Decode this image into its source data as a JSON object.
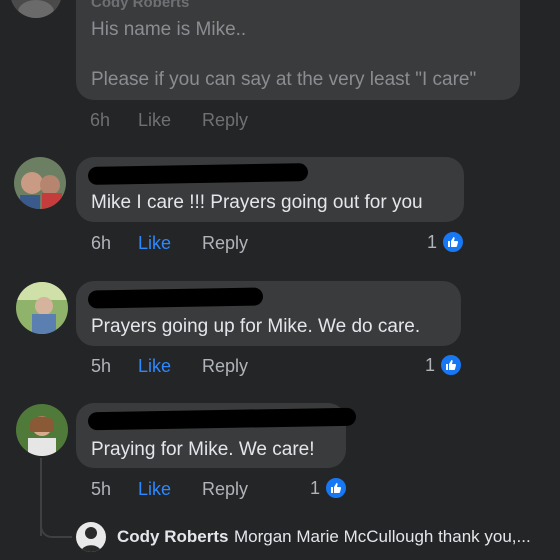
{
  "top_comment": {
    "author": "Cody Roberts",
    "line1": "His name is Mike..",
    "line2": "Please if you can say at the very least \"I care\"",
    "time": "6h",
    "like": "Like",
    "reply": "Reply"
  },
  "comments": [
    {
      "text": "Mike I care !!! Prayers going out for you",
      "time": "6h",
      "like": "Like",
      "reply": "Reply",
      "reactions": "1"
    },
    {
      "text": "Prayers going up for Mike. We do care.",
      "time": "5h",
      "like": "Like",
      "reply": "Reply",
      "reactions": "1"
    },
    {
      "text": "Praying for Mike. We care!",
      "time": "5h",
      "like": "Like",
      "reply": "Reply",
      "reactions": "1"
    }
  ],
  "reply_preview": {
    "author": "Cody Roberts",
    "text": "Morgan Marie McCullough thank you,..."
  },
  "colors": {
    "background": "#242526",
    "bubble": "#3a3b3c",
    "like_blue": "#2d88ff",
    "reaction_badge": "#1877f2"
  }
}
